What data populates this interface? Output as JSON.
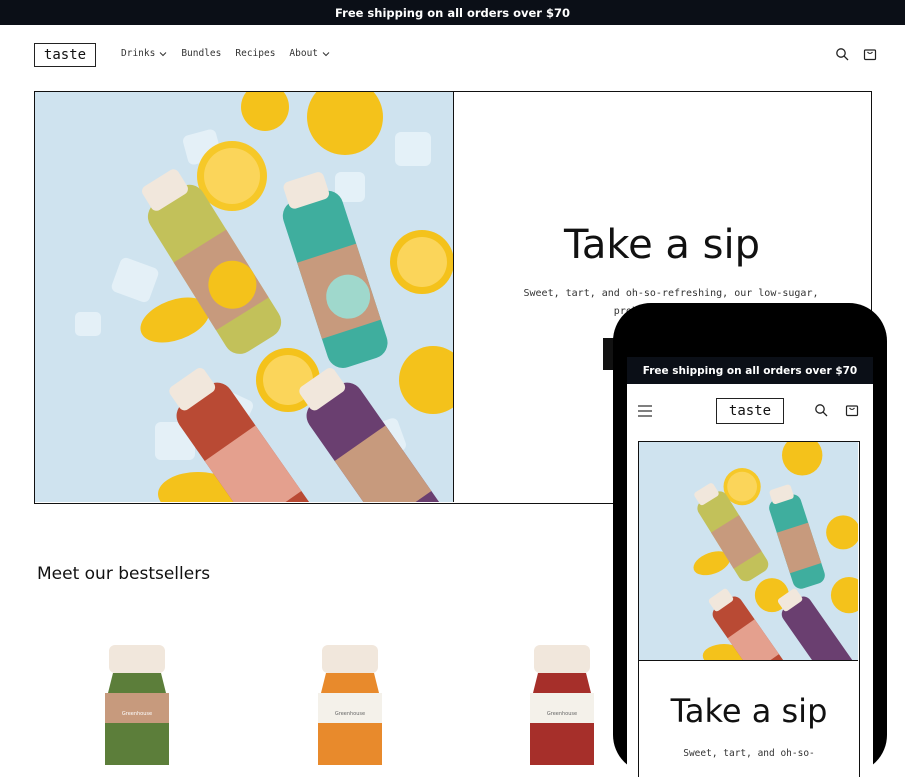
{
  "announcement": "Free shipping on all orders over $70",
  "brand": "taste",
  "nav": {
    "items": [
      {
        "label": "Drinks",
        "has_dropdown": true
      },
      {
        "label": "Bundles",
        "has_dropdown": false
      },
      {
        "label": "Recipes",
        "has_dropdown": false
      },
      {
        "label": "About",
        "has_dropdown": true
      }
    ]
  },
  "header_icons": [
    "search-icon",
    "cart-icon"
  ],
  "hero": {
    "title": "Take a sip",
    "description": "Sweet, tart, and oh-so-refreshing, our low-sugar, probiotic lemonades"
  },
  "bestsellers": {
    "title": "Meet our bestsellers",
    "bottle_label": "Greenhouse"
  },
  "mobile": {
    "announcement": "Free shipping on all orders over $70",
    "brand": "taste",
    "hero_title": "Take a sip",
    "hero_description": "Sweet, tart, and oh-so-"
  },
  "colors": {
    "announcement_bg": "#0b0f17",
    "hero_bg": "#cfe3ef",
    "lemon": "#f4c21b",
    "bottle_green": "#c2c15a",
    "bottle_teal": "#3fae9e",
    "bottle_red": "#b94a34",
    "bottle_purple": "#6a3f70",
    "label_tan": "#c79a7d"
  }
}
